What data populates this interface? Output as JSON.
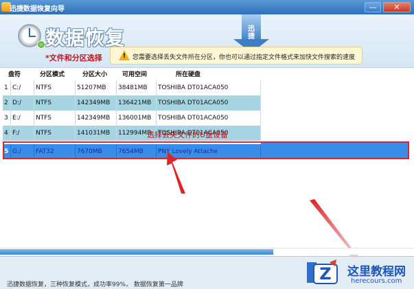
{
  "window": {
    "title": "迅捷数据恢复向导",
    "minimize_label": "—",
    "close_label": "✕"
  },
  "header": {
    "app_heading": "数据恢复",
    "section_label": "*文件和分区选择",
    "brand_badge": "迅捷",
    "hint": "您需要选择丢失文件所在分区，你也可以通过指定文件格式来加快文件搜索的速度"
  },
  "table": {
    "columns": [
      "盘符",
      "分区模式",
      "分区大小",
      "可用空间",
      "所在硬盘"
    ],
    "rows": [
      {
        "index": "1",
        "drive": "C:/",
        "fs": "NTFS",
        "size": "51207MB",
        "free": "38481MB",
        "disk": "TOSHIBA DT01ACA050"
      },
      {
        "index": "2",
        "drive": "D:/",
        "fs": "NTFS",
        "size": "142349MB",
        "free": "136421MB",
        "disk": "TOSHIBA DT01ACA050"
      },
      {
        "index": "3",
        "drive": "E:/",
        "fs": "NTFS",
        "size": "142349MB",
        "free": "136001MB",
        "disk": "TOSHIBA DT01ACA050"
      },
      {
        "index": "4",
        "drive": "F:/",
        "fs": "NTFS",
        "size": "141031MB",
        "free": "112994MB",
        "disk": "TOSHIBA DT01ACA050"
      },
      {
        "index": "5",
        "drive": "G:/",
        "fs": "FAT32",
        "size": "7670MB",
        "free": "7654MB",
        "disk": "PNY Lovely Attache"
      }
    ],
    "selected_index": 4
  },
  "annotation": {
    "callout": "选择丢失文件的U盘设备"
  },
  "progress": {
    "fill_fraction": 0.66
  },
  "footer": {
    "text": "迅捷数据恢复，三种恢复模式，成功率99%， 数据恢复第一品牌"
  },
  "watermark": {
    "title": "这里教程网",
    "subtitle": "herecours.com",
    "icon": "z-logo-icon"
  },
  "colors": {
    "titlebar": "#2e6fb8",
    "alt_row": "#a7d4e3",
    "selected_row": "#3a8eea",
    "annotation_red": "#d9262c",
    "section_red": "#c4121c"
  }
}
